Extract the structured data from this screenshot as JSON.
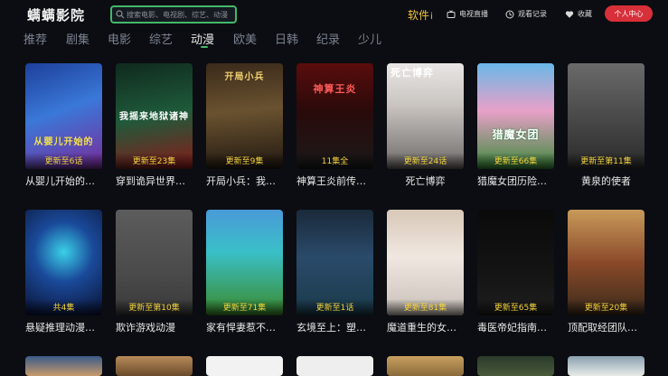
{
  "app": {
    "logo": "螨螨影院"
  },
  "search": {
    "placeholder": "搜索电影、电视剧、综艺、动漫"
  },
  "header": {
    "software_label": "软件",
    "software_info": "i",
    "tv_live": "电视直播",
    "history": "观看记录",
    "favorites": "收藏",
    "user_center": "个人中心"
  },
  "tabs": [
    {
      "label": "推荐"
    },
    {
      "label": "剧集"
    },
    {
      "label": "电影"
    },
    {
      "label": "综艺"
    },
    {
      "label": "动漫",
      "active": true
    },
    {
      "label": "欧美"
    },
    {
      "label": "日韩"
    },
    {
      "label": "纪录"
    },
    {
      "label": "少儿"
    }
  ],
  "colors": {
    "accent_green": "#43b86a",
    "accent_red": "#d8303a",
    "badge_yellow": "#f3d23c",
    "software_yellow": "#f0c43a"
  },
  "grid": {
    "row1": [
      {
        "title": "从婴儿开始的…",
        "ep": "更新至6话",
        "poster_text": "从婴儿开始的"
      },
      {
        "title": "穿到诡异世界…",
        "ep": "更新至23集",
        "poster_text": "我摇来地狱诸神"
      },
      {
        "title": "开局小兵：我…",
        "ep": "更新至9集",
        "poster_text": "开局小兵"
      },
      {
        "title": "神算王炎前传…",
        "ep": "11集全",
        "poster_text": "神算王炎"
      },
      {
        "title": "死亡博弈",
        "ep": "更新至24话",
        "poster_text": "死亡博弈"
      },
      {
        "title": "猎魔女团历险…",
        "ep": "更新至66集",
        "poster_text": "猎魔女团"
      },
      {
        "title": "黄泉的使者",
        "ep": "更新至第11集",
        "poster_text": ""
      }
    ],
    "row2": [
      {
        "title": "悬疑推理动漫…",
        "ep": "共4集"
      },
      {
        "title": "欺诈游戏动漫",
        "ep": "更新至第10集"
      },
      {
        "title": "家有悍妻惹不…",
        "ep": "更新至71集"
      },
      {
        "title": "玄境至上：塑…",
        "ep": "更新至1话"
      },
      {
        "title": "魔道重生的女…",
        "ep": "更新至81集"
      },
      {
        "title": "毒医帝妃指南…",
        "ep": "更新至65集"
      },
      {
        "title": "顶配取经团队…",
        "ep": "更新至20集"
      }
    ]
  }
}
